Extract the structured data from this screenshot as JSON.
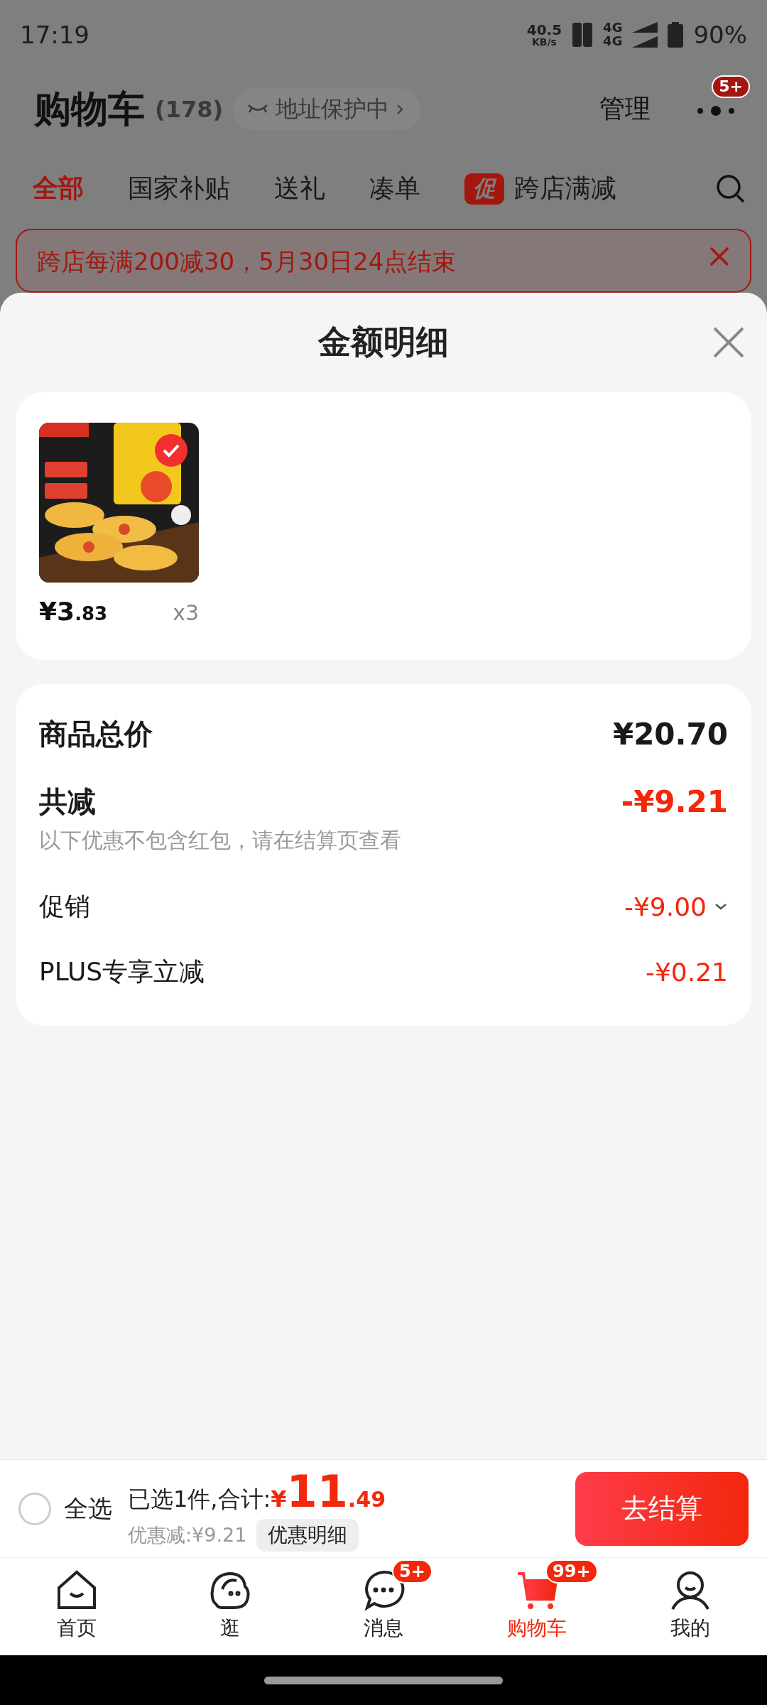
{
  "status_bar": {
    "time": "17:19",
    "net_speed": "40.5",
    "net_unit": "KB/s",
    "network_1": "4G",
    "network_2": "4G",
    "battery": "90%"
  },
  "header": {
    "title": "购物车",
    "count": "(178)",
    "address_chip": "地址保护中",
    "manage": "管理",
    "more_badge": "5+"
  },
  "tabs": [
    {
      "label": "全部",
      "selected": true
    },
    {
      "label": "国家补贴",
      "selected": false
    },
    {
      "label": "送礼",
      "selected": false
    },
    {
      "label": "凑单",
      "selected": false
    },
    {
      "label": "跨店满减",
      "selected": false,
      "tag": "促"
    }
  ],
  "banner": {
    "text": "跨店每满200减30，5月30日24点结束"
  },
  "sheet": {
    "title": "金额明细",
    "items": [
      {
        "kind": "picture",
        "checked": true,
        "price_currency": "¥",
        "price_int": "3",
        "price_dec": ".83",
        "qty": "x3"
      }
    ],
    "total": {
      "label": "商品总价",
      "value": "¥20.70"
    },
    "discount": {
      "label": "共减",
      "value": "-¥9.21",
      "note": "以下优惠不包含红包，请在结算页查看"
    },
    "rows": [
      {
        "label": "促销",
        "value": "-¥9.00",
        "expandable": true
      },
      {
        "label": "PLUS专享立减",
        "value": "-¥0.21",
        "expandable": false
      }
    ]
  },
  "bottom_bar": {
    "select_all": {
      "label": "全选",
      "checked": false
    },
    "selected_text": "已选1件,合计:",
    "currency": "¥",
    "total_int": "11",
    "total_dec": ".49",
    "saving": "优惠减:¥9.21",
    "detail_button": "优惠明细",
    "checkout": "去结算"
  },
  "nav": [
    {
      "label": "首页",
      "selected": false
    },
    {
      "label": "逛",
      "selected": false
    },
    {
      "label": "消息",
      "selected": false,
      "badge": "5+"
    },
    {
      "label": "购物车",
      "selected": true,
      "badge": "99+"
    },
    {
      "label": "我的",
      "selected": false
    }
  ]
}
